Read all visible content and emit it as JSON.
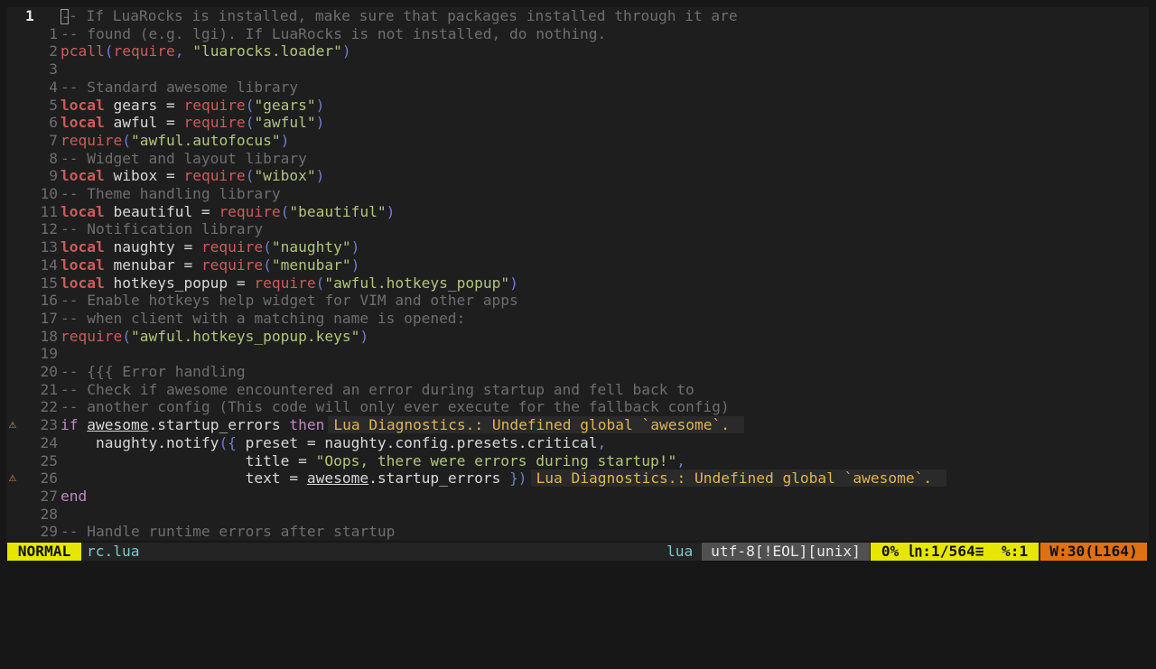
{
  "editor": {
    "lines": [
      {
        "num": "1",
        "cur": true,
        "sign": "",
        "segs": [
          [
            "cursor",
            "-"
          ],
          [
            "c",
            "- If LuaRocks is installed, make sure that packages installed through it are"
          ]
        ]
      },
      {
        "num": "1",
        "sign": "",
        "segs": [
          [
            "c",
            "-- found (e.g. lgi). If LuaRocks is not installed, do nothing."
          ]
        ]
      },
      {
        "num": "2",
        "sign": "",
        "segs": [
          [
            "f",
            "pcall"
          ],
          [
            "p",
            "("
          ],
          [
            "f",
            "require"
          ],
          [
            "p",
            ","
          ],
          [
            "",
            " "
          ],
          [
            "s",
            "\"luarocks.loader\""
          ],
          [
            "p",
            ")"
          ]
        ]
      },
      {
        "num": "3",
        "sign": "",
        "segs": []
      },
      {
        "num": "4",
        "sign": "",
        "segs": [
          [
            "c",
            "-- Standard awesome library"
          ]
        ]
      },
      {
        "num": "5",
        "sign": "",
        "segs": [
          [
            "k",
            "local"
          ],
          [
            "",
            " gears = "
          ],
          [
            "f",
            "require"
          ],
          [
            "p",
            "("
          ],
          [
            "s",
            "\"gears\""
          ],
          [
            "p",
            ")"
          ]
        ]
      },
      {
        "num": "6",
        "sign": "",
        "segs": [
          [
            "k",
            "local"
          ],
          [
            "",
            " awful = "
          ],
          [
            "f",
            "require"
          ],
          [
            "p",
            "("
          ],
          [
            "s",
            "\"awful\""
          ],
          [
            "p",
            ")"
          ]
        ]
      },
      {
        "num": "7",
        "sign": "",
        "segs": [
          [
            "f",
            "require"
          ],
          [
            "p",
            "("
          ],
          [
            "s",
            "\"awful.autofocus\""
          ],
          [
            "p",
            ")"
          ]
        ]
      },
      {
        "num": "8",
        "sign": "",
        "segs": [
          [
            "c",
            "-- Widget and layout library"
          ]
        ]
      },
      {
        "num": "9",
        "sign": "",
        "segs": [
          [
            "k",
            "local"
          ],
          [
            "",
            " wibox = "
          ],
          [
            "f",
            "require"
          ],
          [
            "p",
            "("
          ],
          [
            "s",
            "\"wibox\""
          ],
          [
            "p",
            ")"
          ]
        ]
      },
      {
        "num": "10",
        "sign": "",
        "segs": [
          [
            "c",
            "-- Theme handling library"
          ]
        ]
      },
      {
        "num": "11",
        "sign": "",
        "segs": [
          [
            "k",
            "local"
          ],
          [
            "",
            " beautiful = "
          ],
          [
            "f",
            "require"
          ],
          [
            "p",
            "("
          ],
          [
            "s",
            "\"beautiful\""
          ],
          [
            "p",
            ")"
          ]
        ]
      },
      {
        "num": "12",
        "sign": "",
        "segs": [
          [
            "c",
            "-- Notification library"
          ]
        ]
      },
      {
        "num": "13",
        "sign": "",
        "segs": [
          [
            "k",
            "local"
          ],
          [
            "",
            " naughty = "
          ],
          [
            "f",
            "require"
          ],
          [
            "p",
            "("
          ],
          [
            "s",
            "\"naughty\""
          ],
          [
            "p",
            ")"
          ]
        ]
      },
      {
        "num": "14",
        "sign": "",
        "segs": [
          [
            "k",
            "local"
          ],
          [
            "",
            " menubar = "
          ],
          [
            "f",
            "require"
          ],
          [
            "p",
            "("
          ],
          [
            "s",
            "\"menubar\""
          ],
          [
            "p",
            ")"
          ]
        ]
      },
      {
        "num": "15",
        "sign": "",
        "segs": [
          [
            "k",
            "local"
          ],
          [
            "",
            " hotkeys_popup = "
          ],
          [
            "f",
            "require"
          ],
          [
            "p",
            "("
          ],
          [
            "s",
            "\"awful.hotkeys_popup\""
          ],
          [
            "p",
            ")"
          ]
        ]
      },
      {
        "num": "16",
        "sign": "",
        "segs": [
          [
            "c",
            "-- Enable hotkeys help widget for VIM and other apps"
          ]
        ]
      },
      {
        "num": "17",
        "sign": "",
        "segs": [
          [
            "c",
            "-- when client with a matching name is opened:"
          ]
        ]
      },
      {
        "num": "18",
        "sign": "",
        "segs": [
          [
            "f",
            "require"
          ],
          [
            "p",
            "("
          ],
          [
            "s",
            "\"awful.hotkeys_popup.keys\""
          ],
          [
            "p",
            ")"
          ]
        ]
      },
      {
        "num": "19",
        "sign": "",
        "segs": []
      },
      {
        "num": "20",
        "sign": "",
        "segs": [
          [
            "c",
            "-- {{{ Error handling"
          ]
        ]
      },
      {
        "num": "21",
        "sign": "",
        "segs": [
          [
            "c",
            "-- Check if awesome encountered an error during startup and fell back to"
          ]
        ]
      },
      {
        "num": "22",
        "sign": "",
        "segs": [
          [
            "c",
            "-- another config (This code will only ever execute for the fallback config)"
          ]
        ]
      },
      {
        "num": "23",
        "sign": "⚠",
        "segs": [
          [
            "kw2",
            "if"
          ],
          [
            "",
            " "
          ],
          [
            "u",
            "awesome"
          ],
          [
            "",
            ".startup_errors "
          ],
          [
            "kw2",
            "then"
          ],
          [
            "diag",
            "Lua Diagnostics.: Undefined global `awesome`."
          ]
        ]
      },
      {
        "num": "24",
        "sign": "",
        "segs": [
          [
            "",
            "    naughty.notify"
          ],
          [
            "p",
            "({"
          ],
          [
            "",
            " preset = naughty.config.presets.critical"
          ],
          [
            "p",
            ","
          ]
        ]
      },
      {
        "num": "25",
        "sign": "",
        "segs": [
          [
            "",
            "                     title = "
          ],
          [
            "s",
            "\"Oops, there were errors during startup!\""
          ],
          [
            "p",
            ","
          ]
        ]
      },
      {
        "num": "26",
        "sign": "⚠",
        "segs": [
          [
            "",
            "                     text = "
          ],
          [
            "u",
            "awesome"
          ],
          [
            "",
            ".startup_errors "
          ],
          [
            "p",
            "})"
          ],
          [
            "diag",
            "Lua Diagnostics.: Undefined global `awesome`."
          ]
        ]
      },
      {
        "num": "27",
        "sign": "",
        "segs": [
          [
            "kw2",
            "end"
          ]
        ]
      },
      {
        "num": "28",
        "sign": "",
        "segs": []
      },
      {
        "num": "29",
        "sign": "",
        "segs": [
          [
            "c",
            "-- Handle runtime errors after startup"
          ]
        ]
      }
    ]
  },
  "statusbar": {
    "mode": "NORMAL",
    "filename": "rc.lua",
    "filetype": "lua",
    "encoding": "utf-8[!EOL][unix]",
    "position": "0% ㏑:1/564≡  %:1",
    "warnings": "W:30(L164)"
  }
}
